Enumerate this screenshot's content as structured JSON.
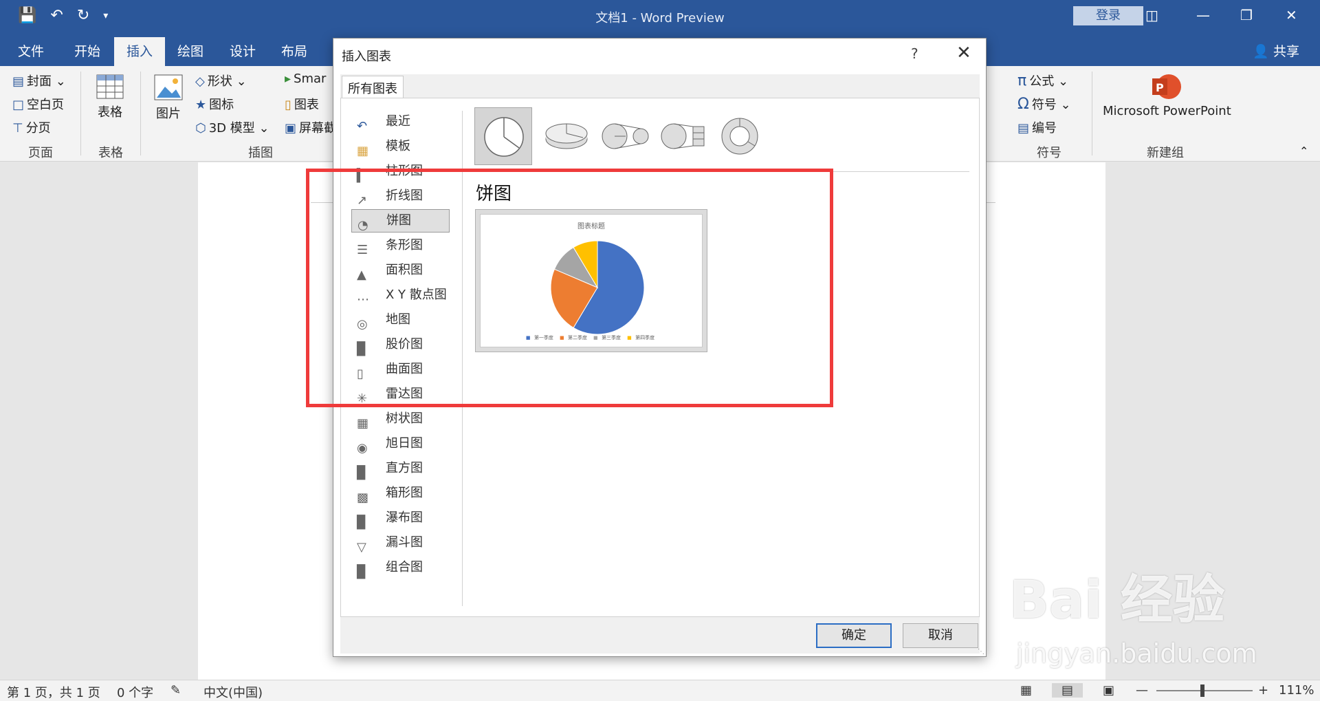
{
  "window": {
    "title": "文档1  -  Word Preview",
    "login": "登录"
  },
  "tabs": [
    "文件",
    "开始",
    "插入",
    "绘图",
    "设计",
    "布局"
  ],
  "share": "共享",
  "ribbon": {
    "pages": {
      "cover": "封面",
      "blank": "空白页",
      "break": "分页",
      "label": "页面"
    },
    "table": {
      "btn": "表格",
      "label": "表格"
    },
    "illus": {
      "picture": "图片",
      "shapes": "形状",
      "icons": "图标",
      "model3d": "3D 模型",
      "smartart": "Smar",
      "chart": "图表",
      "screenshot": "屏幕截",
      "label": "插图"
    },
    "symbols": {
      "equation": "公式",
      "symbol": "符号",
      "number": "编号",
      "label": "符号"
    },
    "newgroup": {
      "ppt": "Microsoft PowerPoint",
      "label": "新建组"
    }
  },
  "status": {
    "page": "第 1 页，共 1 页",
    "words": "0 个字",
    "lang": "中文(中国)",
    "zoom": "111%"
  },
  "dialog": {
    "title": "插入图表",
    "help": "?",
    "tab": "所有图表",
    "categories": [
      "最近",
      "模板",
      "柱形图",
      "折线图",
      "饼图",
      "条形图",
      "面积图",
      "X Y 散点图",
      "地图",
      "股价图",
      "曲面图",
      "雷达图",
      "树状图",
      "旭日图",
      "直方图",
      "箱形图",
      "瀑布图",
      "漏斗图",
      "组合图"
    ],
    "selected_type": "饼图",
    "ok": "确定",
    "cancel": "取消"
  },
  "chart_data": {
    "type": "pie",
    "title": "图表标题",
    "categories": [
      "第一季度",
      "第二季度",
      "第三季度",
      "第四季度"
    ],
    "values": [
      8.2,
      3.2,
      1.4,
      1.2
    ],
    "colors": [
      "#4472c4",
      "#ed7d31",
      "#a5a5a5",
      "#ffc000"
    ]
  },
  "watermark": {
    "main": "Bai 经验",
    "url": "jingyan.baidu.com"
  },
  "accent": "#2b579a",
  "highlight_color": "#ef3b3b"
}
